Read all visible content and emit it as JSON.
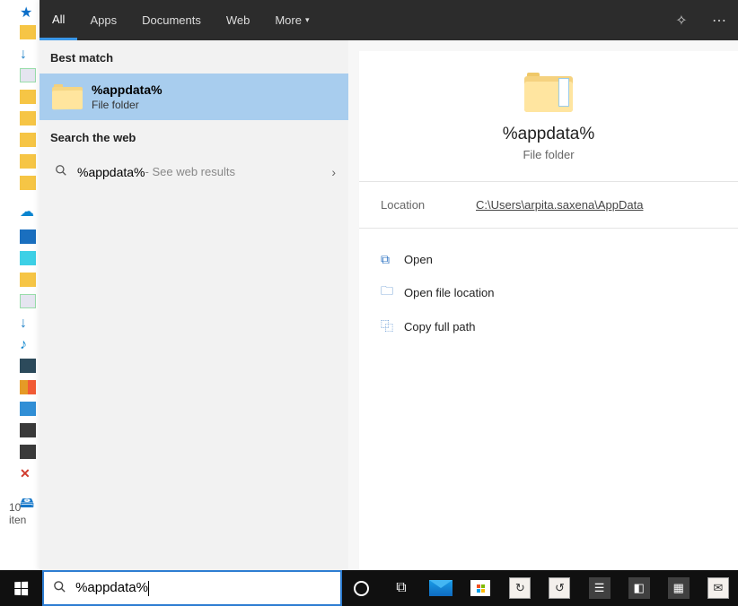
{
  "tabs": {
    "all": "All",
    "apps": "Apps",
    "documents": "Documents",
    "web": "Web",
    "more": "More"
  },
  "sections": {
    "best_match": "Best match",
    "search_web": "Search the web"
  },
  "best_match": {
    "title": "%appdata%",
    "subtitle": "File folder"
  },
  "web_result": {
    "term": "%appdata%",
    "hint": " - See web results"
  },
  "detail": {
    "title": "%appdata%",
    "subtitle": "File folder",
    "location_label": "Location",
    "location_value": "C:\\Users\\arpita.saxena\\AppData",
    "actions": {
      "open": "Open",
      "open_loc": "Open file location",
      "copy_path": "Copy full path"
    }
  },
  "search_input": "%appdata%",
  "statusbar": "10 iten"
}
